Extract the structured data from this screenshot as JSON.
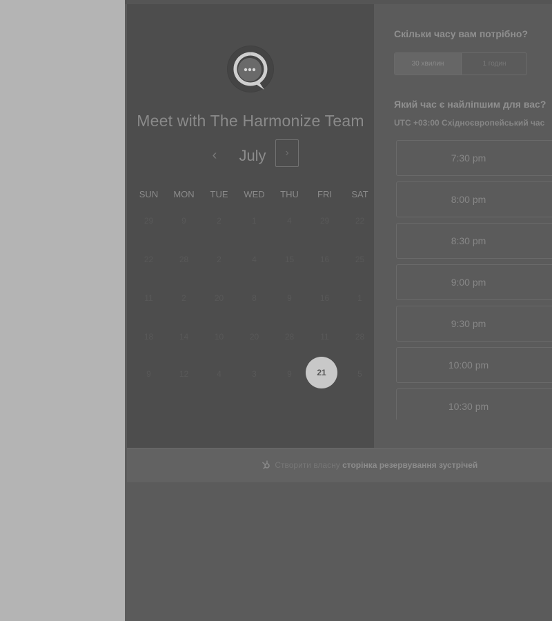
{
  "calendar": {
    "title": "Meet with The Harmonize Team",
    "month": "July",
    "prev_icon": "‹",
    "next_icon": "›",
    "weekdays": [
      "SUN",
      "MON",
      "TUE",
      "WED",
      "THU",
      "FRI",
      "SAT"
    ],
    "weeks": [
      [
        "29",
        "9",
        "2",
        "1",
        "4",
        "29",
        "22"
      ],
      [
        "22",
        "28",
        "2",
        "4",
        "15",
        "16",
        "25"
      ],
      [
        "11",
        "2",
        "20",
        "8",
        "9",
        "16",
        "1"
      ],
      [
        "18",
        "14",
        "10",
        "20",
        "28",
        "11",
        "28"
      ],
      [
        "9",
        "12",
        "4",
        "3",
        "9",
        "21",
        "5"
      ]
    ],
    "selected_day": "21"
  },
  "duration": {
    "question": "Скільки часу вам потрібно?",
    "options": [
      "30 хвилин",
      "1 годин"
    ],
    "selected": "30 хвилин"
  },
  "time": {
    "question": "Який час є найліпшим для вас?",
    "timezone_offset": "UTC +03:00",
    "timezone_name": "Східноєвропейський час",
    "slots": [
      "7:30 pm",
      "8:00 pm",
      "8:30 pm",
      "9:00 pm",
      "9:30 pm",
      "10:00 pm",
      "10:30 pm"
    ]
  },
  "footer": {
    "icon": "hubspot-sprocket-icon",
    "prefix": "Створити власну",
    "link": "сторінка резервування зустрічей"
  },
  "colors": {
    "selected_day_bg": "#c8c8c8",
    "panel_bg": "#4d4d4d"
  }
}
